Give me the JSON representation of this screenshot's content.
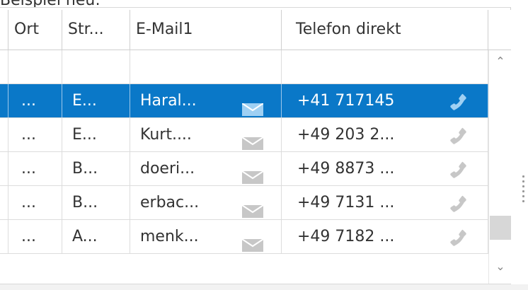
{
  "caption": "Beispiel neu:",
  "columns": [
    "Ort",
    "Str...",
    "E-Mail1",
    "Telefon direkt"
  ],
  "rows": [
    {
      "ort": "",
      "str": "",
      "mail": "",
      "tel": "",
      "selected": false,
      "empty": true
    },
    {
      "ort": "...",
      "str": "E...",
      "mail": "Haral...",
      "tel": "+41 717145",
      "selected": true
    },
    {
      "ort": "...",
      "str": "E...",
      "mail": "Kurt....",
      "tel": "+49 203 2...",
      "selected": false
    },
    {
      "ort": "...",
      "str": "B...",
      "mail": "doeri...",
      "tel": "+49 8873 ...",
      "selected": false
    },
    {
      "ort": "...",
      "str": "B...",
      "mail": "erbac...",
      "tel": "+49 7131 ...",
      "selected": false
    },
    {
      "ort": "...",
      "str": "A...",
      "mail": "menk...",
      "tel": "+49 7182 ...",
      "selected": false
    }
  ],
  "icons": {
    "mail": "envelope-icon",
    "phone": "phone-handset-icon",
    "scroll_up": "chevron-up-icon",
    "scroll_down": "chevron-down-icon"
  },
  "colors": {
    "selection": "#0a78c8",
    "icon_gray": "#c7c7c7",
    "icon_selected": "#9fd0f3"
  }
}
